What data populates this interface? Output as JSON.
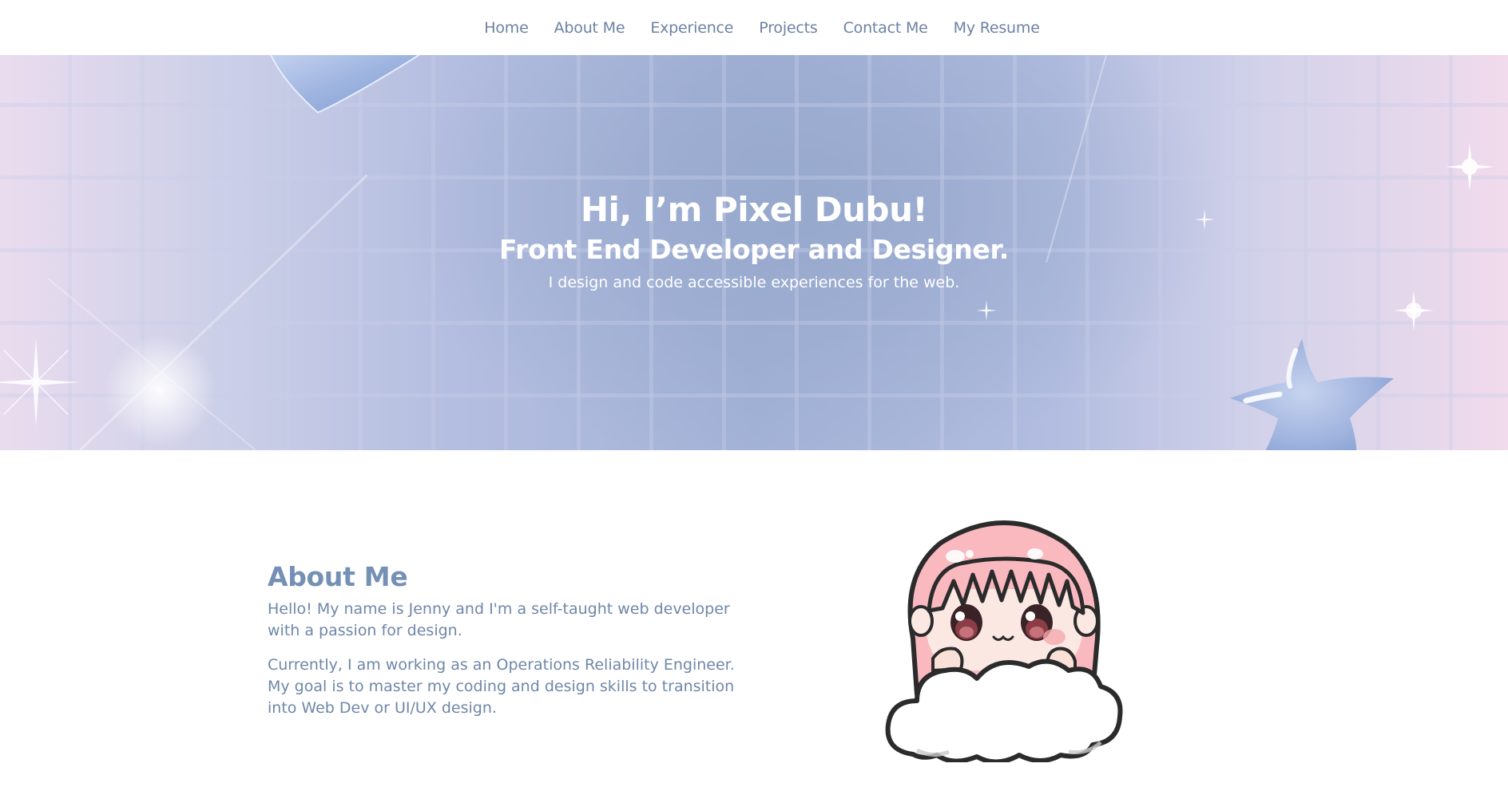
{
  "nav": {
    "items": [
      {
        "label": "Home"
      },
      {
        "label": "About Me"
      },
      {
        "label": "Experience"
      },
      {
        "label": "Projects"
      },
      {
        "label": "Contact Me"
      },
      {
        "label": "My Resume"
      }
    ]
  },
  "hero": {
    "title": "Hi, I’m Pixel Dubu!",
    "subtitle": "Front End Developer and Designer.",
    "tagline": "I design and code accessible experiences for the web."
  },
  "about": {
    "heading": "About Me",
    "paragraph_1": "Hello! My name is Jenny and I'm a self-taught web developer with a passion for design.",
    "paragraph_2": "Currently, I am working as an Operations Reliability Engineer. My goal is to master my coding and design skills to transition into Web Dev or UI/UX design."
  },
  "colors": {
    "nav_text": "#6e82a4",
    "heading": "#7490b4",
    "body_text": "#6f87a8",
    "hero_center": "#96a8cc",
    "hero_pink_edge": "#f1dbec"
  },
  "icons": [
    "heart-shape",
    "star-shape",
    "sparkle",
    "chibi-girl-on-cloud-avatar"
  ]
}
